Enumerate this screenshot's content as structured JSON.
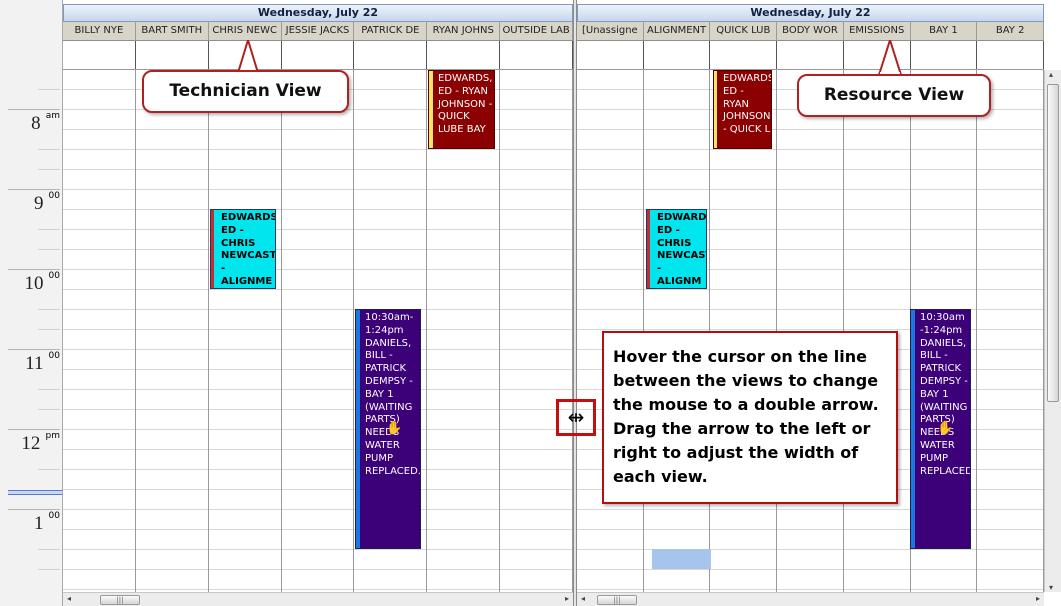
{
  "left_view": {
    "date": "Wednesday, July 22",
    "columns": [
      "BILLY NYE",
      "BART SMITH",
      "CHRIS NEWC",
      "JESSIE JACKS",
      "PATRICK DE",
      "RYAN JOHNS",
      "OUTSIDE LAB"
    ]
  },
  "right_view": {
    "date": "Wednesday, July 22",
    "columns": [
      "[Unassigne",
      "ALIGNMENT",
      "QUICK LUB",
      "BODY WOR",
      "EMISSIONS",
      "BAY 1",
      "BAY 2"
    ]
  },
  "time_labels": [
    {
      "hour": "8",
      "suffix": "am"
    },
    {
      "hour": "9",
      "suffix": "00"
    },
    {
      "hour": "10",
      "suffix": "00"
    },
    {
      "hour": "11",
      "suffix": "00"
    },
    {
      "hour": "12",
      "suffix": "pm"
    },
    {
      "hour": "1",
      "suffix": "00"
    }
  ],
  "appointments": {
    "left_quick_lube": "EDWARDS, ED - RYAN JOHNSON - QUICK LUBE BAY",
    "left_alignment": "EDWARDS, ED - CHRIS NEWCASTLE - ALIGNME",
    "left_bay1": "10:30am-1:24pm DANIELS, BILL - PATRICK DEMPSY - BAY 1 (WAITING PARTS) NEEDS WATER PUMP REPLACED.",
    "right_quick_lube": "EDWARDS, ED - RYAN JOHNSON - QUICK L",
    "right_alignment": "EDWARDS, ED - CHRIS NEWCASTLE - ALIGNM",
    "right_bay1": "10:30am -1:24pm DANIELS, BILL - PATRICK DEMPSY - BAY 1 (WAITING PARTS) NEEDS WATER PUMP REPLACED."
  },
  "callouts": {
    "technician_view": "Technician View",
    "resource_view": "Resource View",
    "instructions": "Hover the cursor on the line between the views to change the mouse to a double arrow. Drag the arrow to the left or right to adjust the width of each view."
  },
  "colors": {
    "appt_red": "#8b0000",
    "appt_cyan": "#00e5ee",
    "appt_purple": "#3c0079",
    "callout_border": "#b02020"
  }
}
